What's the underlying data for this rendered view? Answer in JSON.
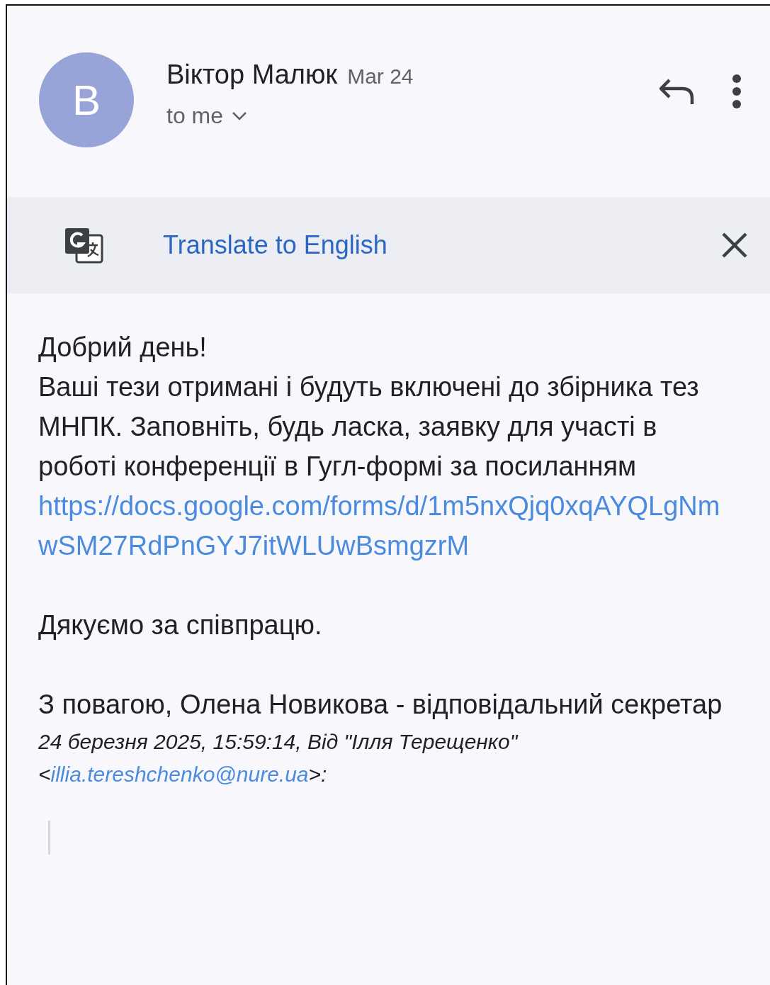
{
  "sender": {
    "avatar_letter": "B",
    "name": "Віктор Малюк",
    "date": "Mar 24",
    "recipient": "to me"
  },
  "translate_bar": {
    "label": "Translate to English"
  },
  "body": {
    "greeting": "Добрий день!",
    "paragraph": "Ваші тези отримані і будуть включені до збірника тез МНПК. Заповніть, будь ласка, заявку для участі в роботі конференції в Гугл-формі за посиланням",
    "link": "https://docs.google.com/forms/d/1m5nxQjq0xqAYQLgNmwSM27RdPnGYJ7itWLUwBsmgzrM",
    "thanks": "Дякуємо за співпрацю.",
    "signature": "З повагою, Олена Новикова - відповідальний секретар"
  },
  "quote_header": {
    "text": "24 березня 2025, 15:59:14, Від \"Ілля Терещенко\" <",
    "email": "illia.tereshchenko@nure.ua",
    "suffix": ">:"
  }
}
